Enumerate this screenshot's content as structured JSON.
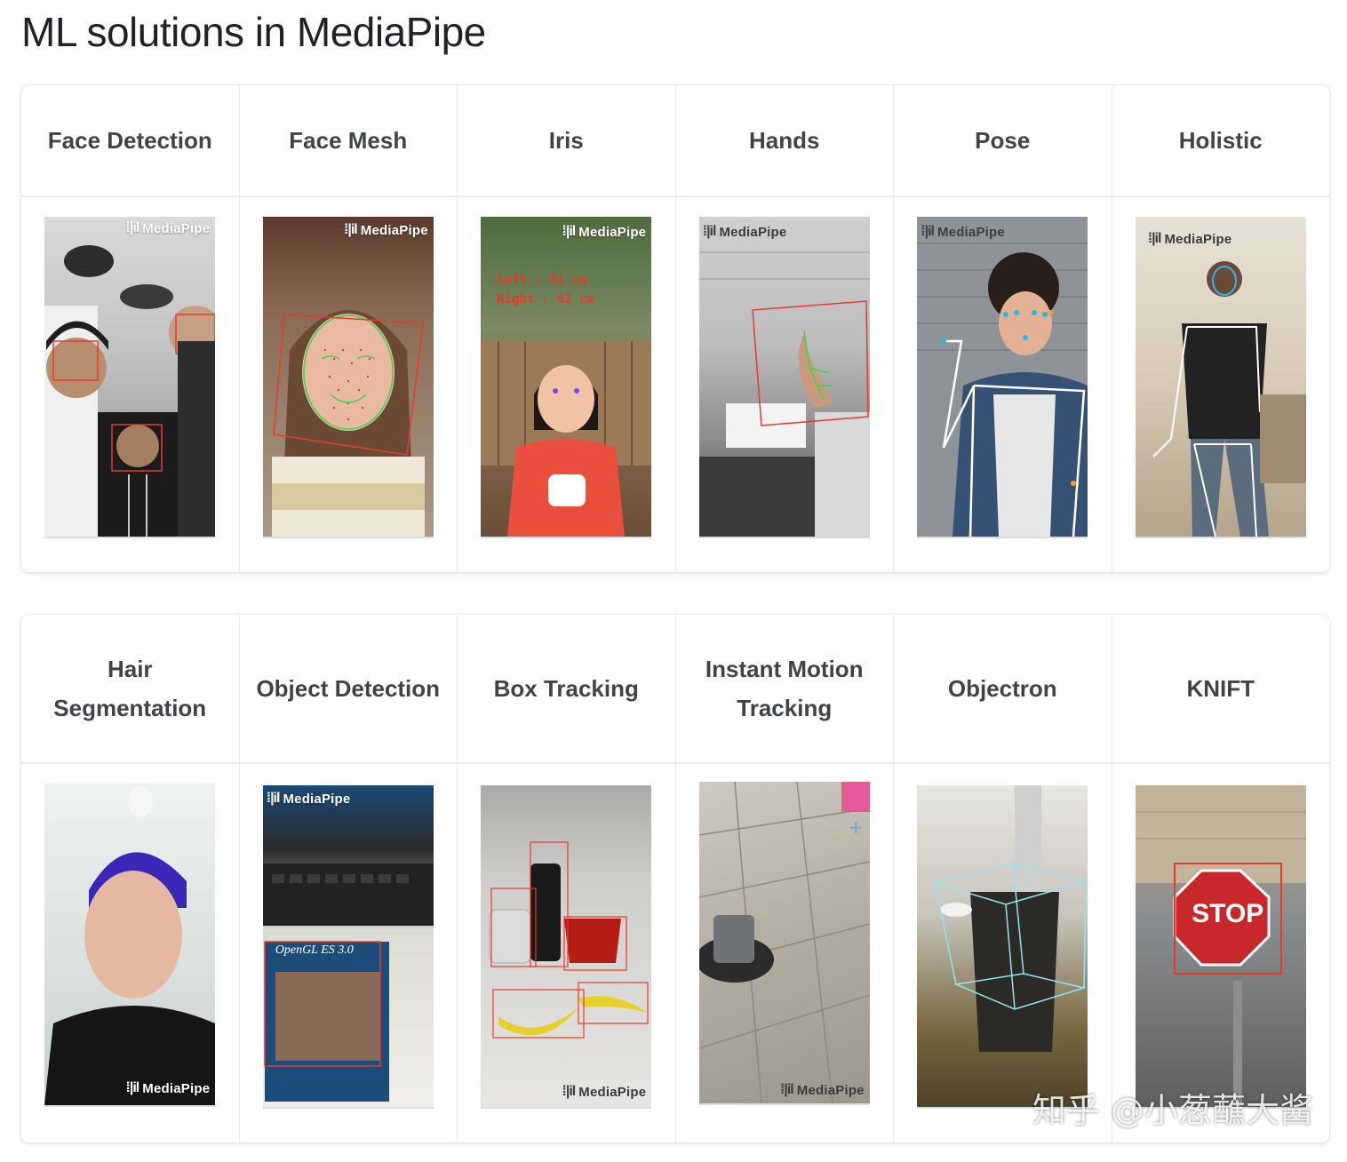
{
  "page": {
    "title": "ML solutions in MediaPipe"
  },
  "brand": {
    "watermark": "MediaPipe",
    "logo_glyph": "⁞|il"
  },
  "colors": {
    "card_border": "#e6e8eb",
    "header_text": "#404448",
    "overlay_red": "#e63a2a",
    "landmark_green": "#3cd64a"
  },
  "site_watermark": "知乎 @小葱蘸大酱",
  "row1": {
    "columns": [
      {
        "label": "Face Detection",
        "image": "face-detection-demo"
      },
      {
        "label": "Face Mesh",
        "image": "face-mesh-demo"
      },
      {
        "label": "Iris",
        "image": "iris-demo",
        "overlay": [
          "Left : 61 cm",
          "Right : 62 cm"
        ]
      },
      {
        "label": "Hands",
        "image": "hands-demo"
      },
      {
        "label": "Pose",
        "image": "pose-demo"
      },
      {
        "label": "Holistic",
        "image": "holistic-demo"
      }
    ]
  },
  "row2": {
    "columns": [
      {
        "label": "Hair Segmentation",
        "image": "hair-segmentation-demo"
      },
      {
        "label": "Object Detection",
        "image": "object-detection-demo",
        "book": "OpenGL ES 3.0"
      },
      {
        "label": "Box Tracking",
        "image": "box-tracking-demo"
      },
      {
        "label": "Instant Motion Tracking",
        "image": "instant-motion-tracking-demo"
      },
      {
        "label": "Objectron",
        "image": "objectron-demo"
      },
      {
        "label": "KNIFT",
        "image": "knift-demo",
        "sign": "STOP"
      }
    ]
  }
}
